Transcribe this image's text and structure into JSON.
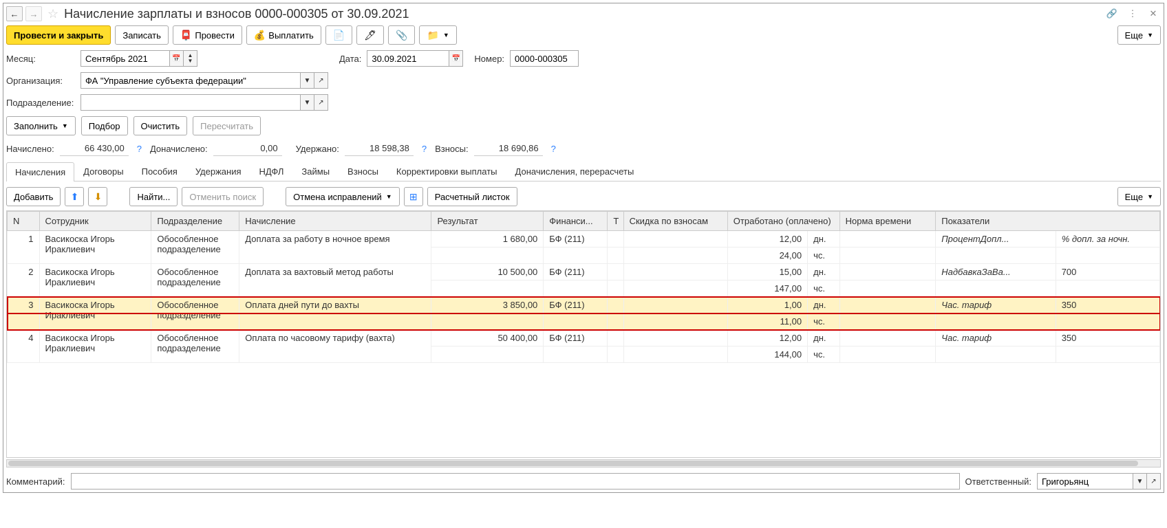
{
  "header": {
    "title": "Начисление зарплаты и взносов 0000-000305 от 30.09.2021"
  },
  "toolbar": {
    "post_close": "Провести и закрыть",
    "write": "Записать",
    "post": "Провести",
    "pay": "Выплатить",
    "more": "Еще"
  },
  "form": {
    "month_label": "Месяц:",
    "month_value": "Сентябрь 2021",
    "date_label": "Дата:",
    "date_value": "30.09.2021",
    "number_label": "Номер:",
    "number_value": "0000-000305",
    "org_label": "Организация:",
    "org_value": "ФА \"Управление субъекта федерации\"",
    "dept_label": "Подразделение:",
    "dept_value": ""
  },
  "actions": {
    "fill": "Заполнить",
    "select": "Подбор",
    "clear": "Очистить",
    "recalc": "Пересчитать"
  },
  "totals": {
    "accrued_label": "Начислено:",
    "accrued": "66 430,00",
    "extra_label": "Доначислено:",
    "extra": "0,00",
    "withheld_label": "Удержано:",
    "withheld": "18 598,38",
    "contrib_label": "Взносы:",
    "contrib": "18 690,86"
  },
  "tabs": [
    "Начисления",
    "Договоры",
    "Пособия",
    "Удержания",
    "НДФЛ",
    "Займы",
    "Взносы",
    "Корректировки выплаты",
    "Доначисления, перерасчеты"
  ],
  "tab_toolbar": {
    "add": "Добавить",
    "find": "Найти...",
    "cancel_search": "Отменить поиск",
    "cancel_fix": "Отмена исправлений",
    "payslip": "Расчетный листок",
    "more": "Еще"
  },
  "columns": [
    "N",
    "Сотрудник",
    "Подразделение",
    "Начисление",
    "Результат",
    "Финанси...",
    "Т",
    "Скидка по взносам",
    "Отработано (оплачено)",
    "Норма времени",
    "Показатели"
  ],
  "rows": [
    {
      "n": "1",
      "emp": "Васикоска Игорь Ираклиевич",
      "dept": "Обособленное подразделение",
      "acc": "Доплата за работу в ночное время",
      "res": "1 680,00",
      "fin": "БФ (211)",
      "work_d": "12,00",
      "work_d_u": "дн.",
      "work_h": "24,00",
      "work_h_u": "чс.",
      "ind": "ПроцентДопл...",
      "ind2": "% допл. за ночн."
    },
    {
      "n": "2",
      "emp": "Васикоска Игорь Ираклиевич",
      "dept": "Обособленное подразделение",
      "acc": "Доплата за вахтовый метод работы",
      "res": "10 500,00",
      "fin": "БФ (211)",
      "work_d": "15,00",
      "work_d_u": "дн.",
      "work_h": "147,00",
      "work_h_u": "чс.",
      "ind": "НадбавкаЗаВа...",
      "ind2": "700"
    },
    {
      "n": "3",
      "emp": "Васикоска Игорь Ираклиевич",
      "dept": "Обособленное подразделение",
      "acc": "Оплата дней пути до вахты",
      "res": "3 850,00",
      "fin": "БФ (211)",
      "work_d": "1,00",
      "work_d_u": "дн.",
      "work_h": "11,00",
      "work_h_u": "чс.",
      "ind": "Час. тариф",
      "ind2": "350"
    },
    {
      "n": "4",
      "emp": "Васикоска Игорь Ираклиевич",
      "dept": "Обособленное подразделение",
      "acc": "Оплата по часовому тарифу (вахта)",
      "res": "50 400,00",
      "fin": "БФ (211)",
      "work_d": "12,00",
      "work_d_u": "дн.",
      "work_h": "144,00",
      "work_h_u": "чс.",
      "ind": "Час. тариф",
      "ind2": "350"
    }
  ],
  "footer": {
    "comment_label": "Комментарий:",
    "resp_label": "Ответственный:",
    "resp_value": "Григорьянц"
  }
}
